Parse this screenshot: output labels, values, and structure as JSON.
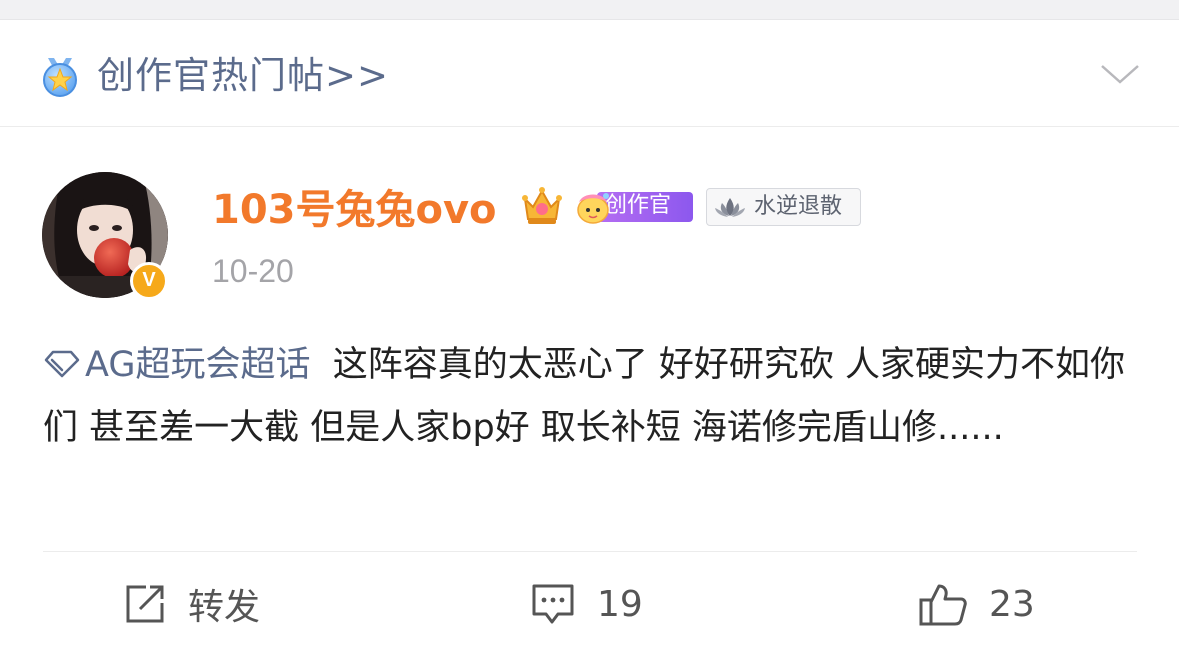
{
  "header": {
    "title": "创作官热门帖>>",
    "medal_icon": "medal-star-icon",
    "collapse_icon": "chevron-down-icon"
  },
  "author": {
    "name": "103号兔兔ovo",
    "verified_badge": "V",
    "badges": {
      "crown": "crown-icon",
      "creator": "创作官",
      "water": "水逆退散"
    },
    "date": "10-20"
  },
  "post": {
    "topic": "AG超玩会超话",
    "text": "这阵容真的太恶心了 好好研究砍 人家硬实力不如你们 甚至差一大截 但是人家bp好 取长补短 海诺修完盾山修......"
  },
  "actions": {
    "repost": "转发",
    "comments": "19",
    "likes": "23"
  },
  "colors": {
    "username": "#f2792b",
    "link": "#5b6b8c",
    "text": "#222222",
    "muted": "#a4a4a8"
  }
}
